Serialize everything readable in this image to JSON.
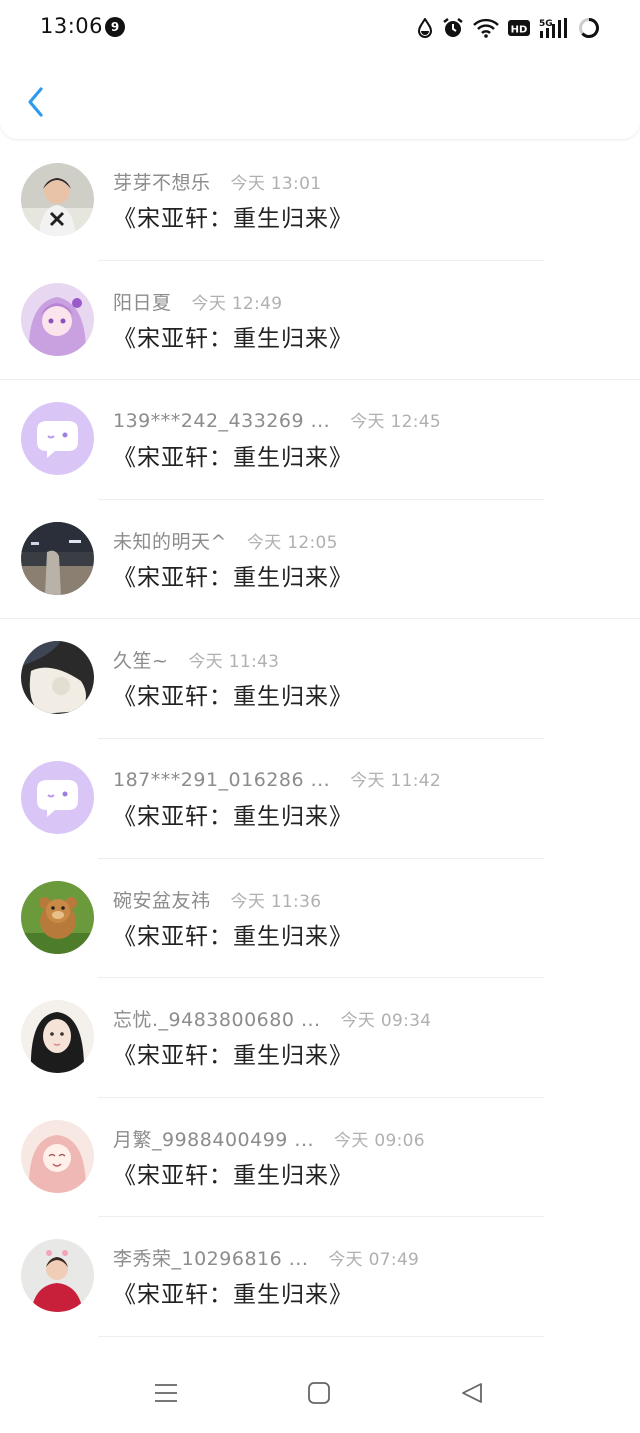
{
  "status_bar": {
    "time": "13:06",
    "notification_count": "9",
    "icons": [
      "water-drop-icon",
      "alarm-icon",
      "wifi-icon",
      "hd-icon",
      "signal-5g-icon",
      "battery-icon"
    ],
    "hd_label": "HD",
    "network_label": "5G"
  },
  "header": {
    "back_icon": "chevron-left-icon",
    "accent_color": "#2f9bf0"
  },
  "messages": [
    {
      "name": "芽芽不想乐",
      "time": "今天 13:01",
      "title": "《宋亚轩：重生归来》",
      "avatar": "avatar-child-photo"
    },
    {
      "name": "阳日夏",
      "time": "今天 12:49",
      "title": "《宋亚轩：重生归来》",
      "avatar": "avatar-anime-purple"
    },
    {
      "name": "139***242_433269 ...",
      "time": "今天 12:45",
      "title": "《宋亚轩：重生归来》",
      "avatar": "default-chat-avatar"
    },
    {
      "name": "未知的明天^",
      "time": "今天 12:05",
      "title": "《宋亚轩：重生归来》",
      "avatar": "avatar-night-street"
    },
    {
      "name": "久笙~",
      "time": "今天 11:43",
      "title": "《宋亚轩：重生归来》",
      "avatar": "avatar-cat-photo"
    },
    {
      "name": "187***291_016286 ...",
      "time": "今天 11:42",
      "title": "《宋亚轩：重生归来》",
      "avatar": "default-chat-avatar"
    },
    {
      "name": "碗安盆友祎",
      "time": "今天 11:36",
      "title": "《宋亚轩：重生归来》",
      "avatar": "avatar-bear-cartoon"
    },
    {
      "name": "忘忧._9483800680 ...",
      "time": "今天 09:34",
      "title": "《宋亚轩：重生归来》",
      "avatar": "avatar-girl-portrait"
    },
    {
      "name": "月繁_9988400499 ...",
      "time": "今天 09:06",
      "title": "《宋亚轩：重生归来》",
      "avatar": "avatar-pink-anime"
    },
    {
      "name": "李秀荣_10296816 ...",
      "time": "今天 07:49",
      "title": "《宋亚轩：重生归来》",
      "avatar": "avatar-woman-red"
    }
  ],
  "nav_bar": {
    "icons": [
      "menu-icon",
      "home-icon",
      "back-triangle-icon"
    ]
  }
}
